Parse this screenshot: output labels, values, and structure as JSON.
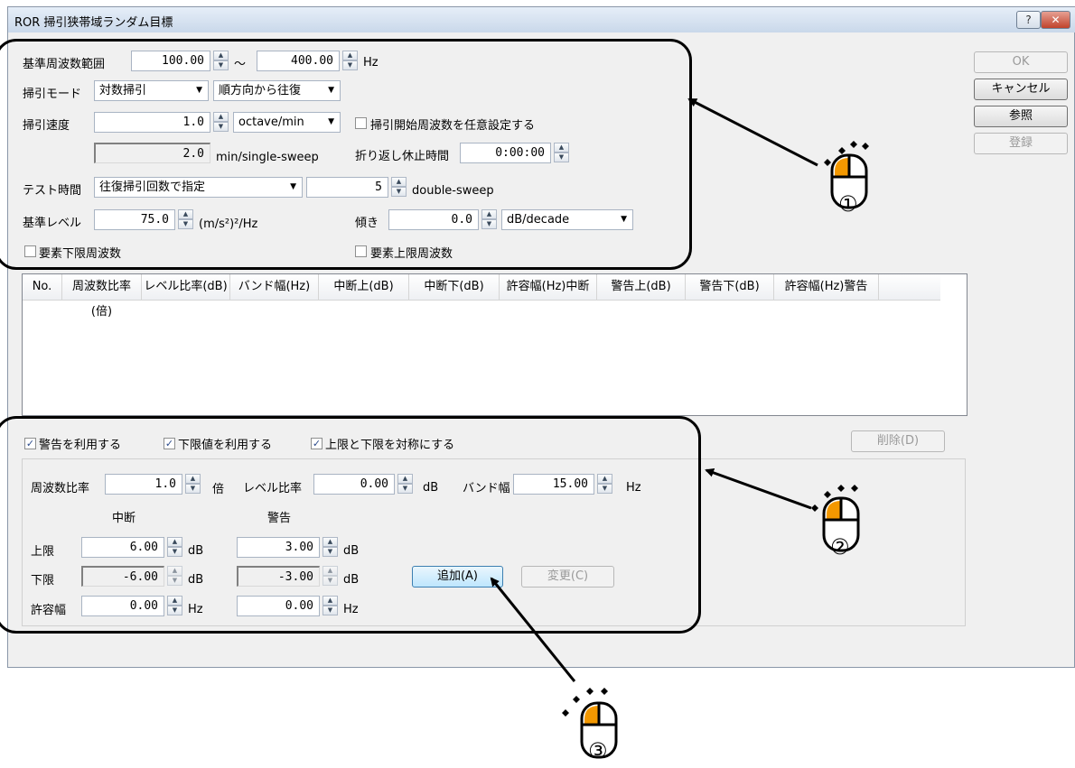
{
  "window": {
    "title": "ROR 掃引狭帯域ランダム目標",
    "help_label": "?",
    "close_label": "✕"
  },
  "side_buttons": {
    "ok": "OK",
    "cancel": "キャンセル",
    "browse": "参照",
    "register": "登録"
  },
  "sweep": {
    "base_range_label": "基準周波数範囲",
    "freq_from": "100.00",
    "tilde": "～",
    "freq_to": "400.00",
    "hz": "Hz",
    "mode_label": "掃引モード",
    "mode_value": "対数掃引",
    "direction_value": "順方向から往復",
    "speed_label": "掃引速度",
    "speed_value": "1.0",
    "speed_unit": "octave/min",
    "custom_start_label": "掃引開始周波数を任意設定する",
    "time_per_sweep": "2.0",
    "time_per_sweep_unit": "min/single-sweep",
    "turnaround_label": "折り返し休止時間",
    "turnaround_value": "0:00:00",
    "test_time_label": "テスト時間",
    "test_time_mode": "往復掃引回数で指定",
    "sweep_count": "5",
    "sweep_count_unit": "double-sweep",
    "base_level_label": "基準レベル",
    "base_level_value": "75.0",
    "base_level_unit": "(m/s²)²/Hz",
    "slope_label": "傾き",
    "slope_value": "0.0",
    "slope_unit": "dB/decade",
    "lower_freq_label": "要素下限周波数",
    "upper_freq_label": "要素上限周波数"
  },
  "table": {
    "columns": [
      "No.",
      "周波数比率(倍)",
      "レベル比率(dB)",
      "バンド幅(Hz)",
      "中断上(dB)",
      "中断下(dB)",
      "許容幅(Hz)中断",
      "警告上(dB)",
      "警告下(dB)",
      "許容幅(Hz)警告"
    ]
  },
  "editor": {
    "use_warning": "警告を利用する",
    "use_lower": "下限値を利用する",
    "symmetric": "上限と下限を対称にする",
    "delete_label": "削除(D)",
    "freq_ratio_label": "周波数比率",
    "freq_ratio_value": "1.0",
    "freq_ratio_unit": "倍",
    "level_ratio_label": "レベル比率",
    "level_ratio_value": "0.00",
    "db": "dB",
    "bandwidth_label": "バンド幅",
    "bandwidth_value": "15.00",
    "hz": "Hz",
    "abort_header": "中断",
    "warning_header": "警告",
    "upper_label": "上限",
    "upper_abort": "6.00",
    "upper_warning": "3.00",
    "lower_label": "下限",
    "lower_abort": "-6.00",
    "lower_warning": "-3.00",
    "tolerance_label": "許容幅",
    "tolerance_abort": "0.00",
    "tolerance_warning": "0.00",
    "add_label": "追加(A)",
    "change_label": "変更(C)"
  },
  "annotations": {
    "mark1": "①",
    "mark2": "②",
    "mark3": "③"
  },
  "colors": {
    "mouse_button": "#f39800"
  }
}
